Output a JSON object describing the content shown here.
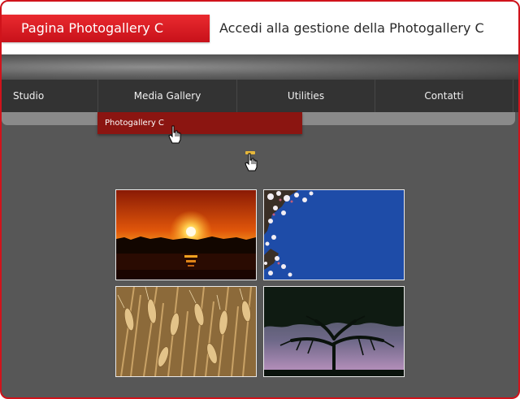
{
  "header": {
    "title": "Pagina Photogallery C",
    "subtitle": "Accedi alla gestione della Photogallery C"
  },
  "nav": {
    "items": [
      {
        "label": "Studio"
      },
      {
        "label": "Media Gallery"
      },
      {
        "label": "Utilities"
      },
      {
        "label": "Contatti"
      }
    ],
    "submenu": [
      {
        "label": "Photogallery C"
      }
    ]
  },
  "colors": {
    "accent_red": "#d0131b",
    "submenu_bg": "#8b1511",
    "nav_bg": "#333333",
    "page_bg": "#575757"
  },
  "gallery": {
    "thumbnails": [
      {
        "subject": "sunset"
      },
      {
        "subject": "blossom-sky"
      },
      {
        "subject": "wheat"
      },
      {
        "subject": "tree-silhouette"
      }
    ]
  }
}
